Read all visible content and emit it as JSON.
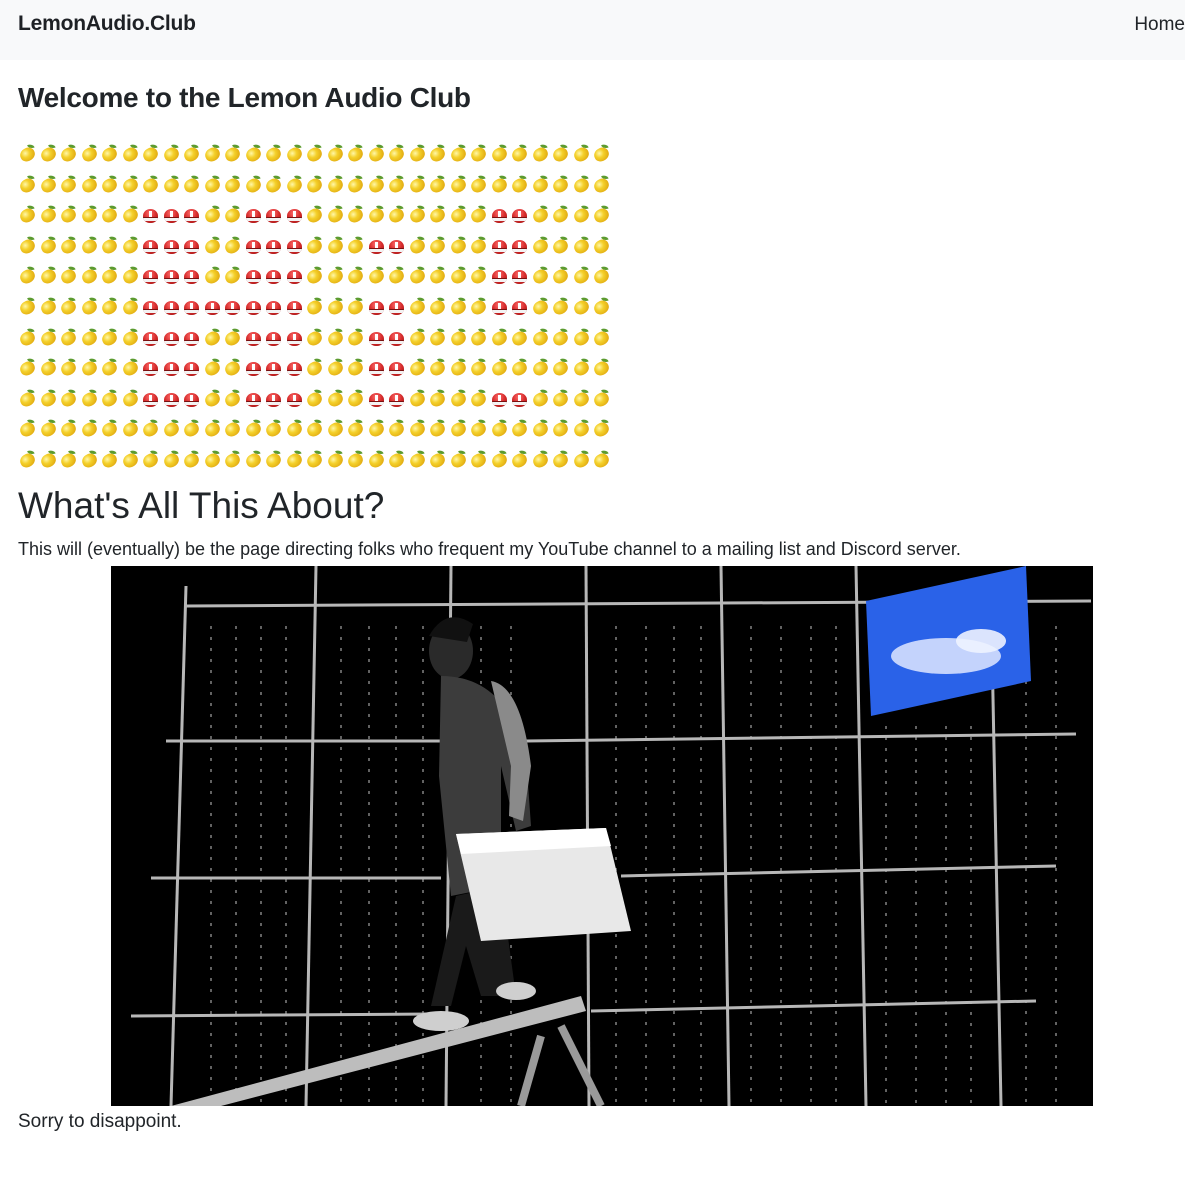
{
  "navbar": {
    "brand": "LemonAudio.Club",
    "home_link": "Home"
  },
  "main": {
    "title": "Welcome to the Lemon Audio Club",
    "emoji_grid": {
      "columns": 29,
      "rows": [
        "LLLLLLLLLLLLLLLLLLLLLLLLLLLLL",
        "LLLLLLLLLLLLLLLLLLLLLLLLLLLLL",
        "LLLLLLHHHLLHHHLLLLLLLLLHHLLLL",
        "LLLLLLHHHLLHHHLLLHHLLLLHHLLLL",
        "LLLLLLHHHLLHHHLLLLLLLLLHHLLLL",
        "LLLLLLHHHHHHHHLLLHHLLLLHHLLLL",
        "LLLLLLHHHLLHHHLLLHHLLLLLLLLLL",
        "LLLLLLHHHLLHHHLLLHHLLLLLLLLLL",
        "LLLLLLHHHLLHHHLLLHHLLLLHHLLLL",
        "LLLLLLLLLLLLLLLLLLLLLLLLLLLLL",
        "LLLLLLLLLLLLLLLLLLLLLLLLLLLLL"
      ],
      "legend": {
        "L": "lemon-icon",
        "H": "rescue-helmet-icon"
      }
    },
    "about_title": "What's All This About?",
    "about_text": "This will (eventually) be the page directing folks who frequent my YouTube channel to a mailing list and Discord server.",
    "video": {
      "description_icon": "video-frame-man-with-briefcase"
    },
    "footer_text": "Sorry to disappoint."
  }
}
